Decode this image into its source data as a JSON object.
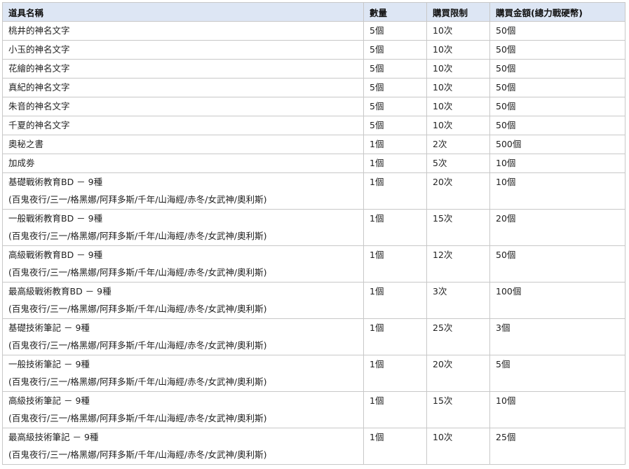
{
  "table": {
    "headers": [
      "道具名稱",
      "數量",
      "購買限制",
      "購買金額(總力戰硬幣)"
    ],
    "rows": [
      {
        "name": "桃井的神名文字",
        "sub": "",
        "qty": "5個",
        "limit": "10次",
        "price": "50個"
      },
      {
        "name": "小玉的神名文字",
        "sub": "",
        "qty": "5個",
        "limit": "10次",
        "price": "50個"
      },
      {
        "name": "花繪的神名文字",
        "sub": "",
        "qty": "5個",
        "limit": "10次",
        "price": "50個"
      },
      {
        "name": "真紀的神名文字",
        "sub": "",
        "qty": "5個",
        "limit": "10次",
        "price": "50個"
      },
      {
        "name": "朱音的神名文字",
        "sub": "",
        "qty": "5個",
        "limit": "10次",
        "price": "50個"
      },
      {
        "name": "千夏的神名文字",
        "sub": "",
        "qty": "5個",
        "limit": "10次",
        "price": "50個"
      },
      {
        "name": "奧秘之書",
        "sub": "",
        "qty": "1個",
        "limit": "2次",
        "price": "500個"
      },
      {
        "name": "加成劵",
        "sub": "",
        "qty": "1個",
        "limit": "5次",
        "price": "10個"
      },
      {
        "name": "基礎戰術教育BD － 9種",
        "sub": "(百鬼夜行/三一/格黑娜/阿拜多斯/千年/山海經/赤冬/女武神/奧利斯)",
        "qty": "1個",
        "limit": "20次",
        "price": "10個"
      },
      {
        "name": "一般戰術教育BD － 9種",
        "sub": "(百鬼夜行/三一/格黑娜/阿拜多斯/千年/山海經/赤冬/女武神/奧利斯)",
        "qty": "1個",
        "limit": "15次",
        "price": "20個"
      },
      {
        "name": "高級戰術教育BD － 9種",
        "sub": "(百鬼夜行/三一/格黑娜/阿拜多斯/千年/山海經/赤冬/女武神/奧利斯)",
        "qty": "1個",
        "limit": "12次",
        "price": "50個"
      },
      {
        "name": "最高級戰術教育BD － 9種",
        "sub": "(百鬼夜行/三一/格黑娜/阿拜多斯/千年/山海經/赤冬/女武神/奧利斯)",
        "qty": "1個",
        "limit": "3次",
        "price": "100個"
      },
      {
        "name": "基礎技術筆記 － 9種",
        "sub": "(百鬼夜行/三一/格黑娜/阿拜多斯/千年/山海經/赤冬/女武神/奧利斯)",
        "qty": "1個",
        "limit": "25次",
        "price": "3個"
      },
      {
        "name": "一般技術筆記 － 9種",
        "sub": "(百鬼夜行/三一/格黑娜/阿拜多斯/千年/山海經/赤冬/女武神/奧利斯)",
        "qty": "1個",
        "limit": "20次",
        "price": "5個"
      },
      {
        "name": "高級技術筆記 － 9種",
        "sub": "(百鬼夜行/三一/格黑娜/阿拜多斯/千年/山海經/赤冬/女武神/奧利斯)",
        "qty": "1個",
        "limit": "15次",
        "price": "10個"
      },
      {
        "name": "最高級技術筆記 － 9種",
        "sub": "(百鬼夜行/三一/格黑娜/阿拜多斯/千年/山海經/赤冬/女武神/奧利斯)",
        "qty": "1個",
        "limit": "10次",
        "price": "25個"
      }
    ]
  }
}
